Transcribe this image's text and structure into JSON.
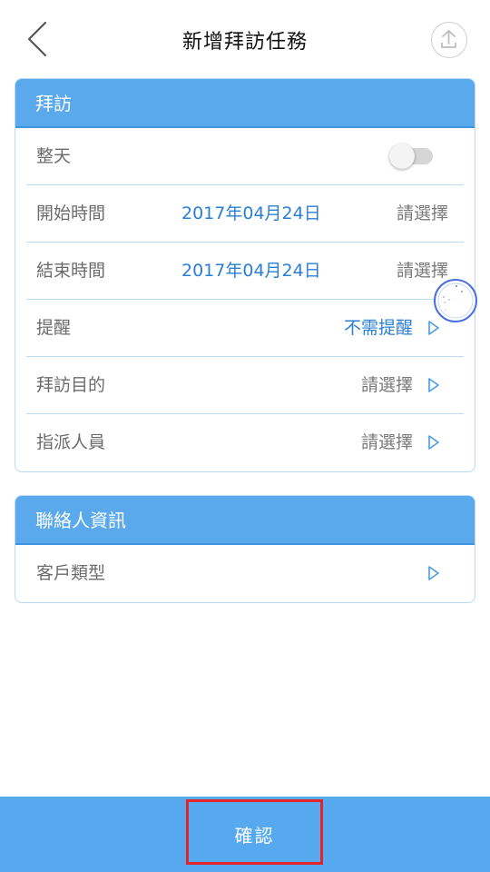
{
  "header": {
    "title": "新增拜訪任務"
  },
  "visit_section": {
    "title": "拜訪",
    "rows": [
      {
        "label": "整天",
        "toggle_on": false
      },
      {
        "label": "開始時間",
        "date": "2017年04月24日",
        "value": "請選擇"
      },
      {
        "label": "結束時間",
        "date": "2017年04月24日",
        "value": "請選擇"
      },
      {
        "label": "提醒",
        "value": "不需提醒"
      },
      {
        "label": "拜訪目的",
        "value": "請選擇"
      },
      {
        "label": "指派人員",
        "value": "請選擇"
      }
    ]
  },
  "contact_section": {
    "title": "聯絡人資訊",
    "rows": [
      {
        "label": "客戶類型"
      }
    ]
  },
  "footer": {
    "confirm_label": "確認"
  },
  "colors": {
    "accent": "#5aa9ec",
    "date_text": "#2a7fd4",
    "confirm_highlight": "#e2232a"
  }
}
